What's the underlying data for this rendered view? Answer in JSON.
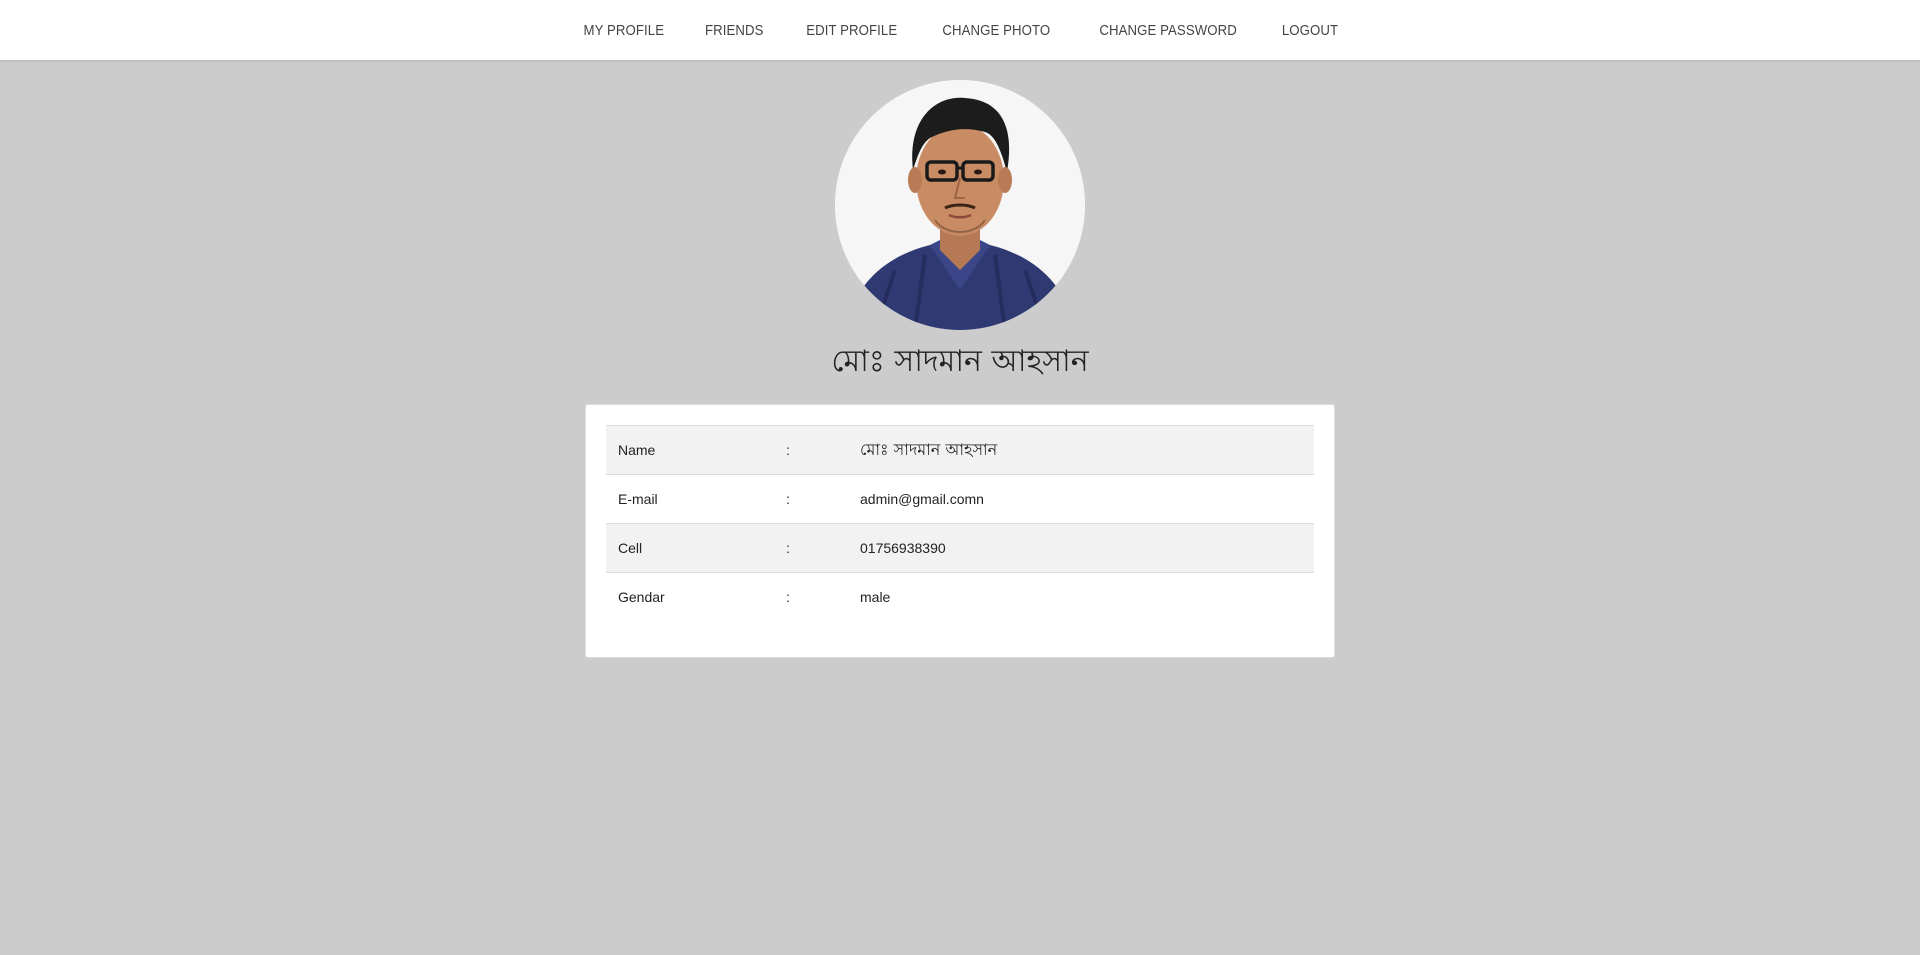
{
  "nav": {
    "items": [
      {
        "label": "MY PROFILE"
      },
      {
        "label": "FRIENDS"
      },
      {
        "label": "EDIT PROFILE"
      },
      {
        "label": "CHANGE PHOTO"
      },
      {
        "label": "CHANGE PASSWORD"
      },
      {
        "label": "LOGOUT"
      }
    ]
  },
  "profile": {
    "avatar_icon": "profile-photo",
    "name": "মোঃ সাদমান আহসান"
  },
  "details": {
    "separator": ":",
    "rows": [
      {
        "label": "Name",
        "value": "মোঃ সাদমান আহসান"
      },
      {
        "label": "E-mail",
        "value": "admin@gmail.comn"
      },
      {
        "label": "Cell",
        "value": "01756938390"
      },
      {
        "label": "Gendar",
        "value": "male"
      }
    ]
  },
  "colors": {
    "page_background": "#cccccc",
    "nav_background": "#ffffff",
    "card_background": "#ffffff",
    "striped_row": "#f2f2f2"
  }
}
